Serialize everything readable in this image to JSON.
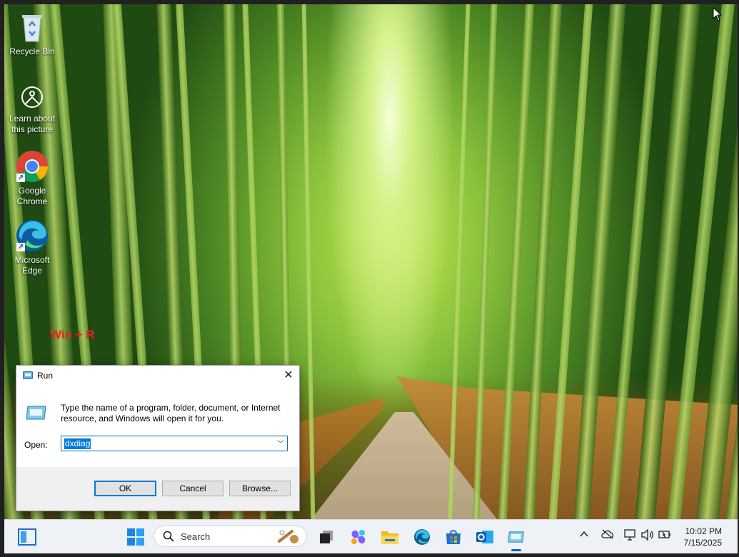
{
  "desktop": {
    "icons": [
      {
        "label": "Recycle Bin",
        "icon": "recycle-bin-icon"
      },
      {
        "label": "Learn about this picture",
        "icon": "learn-about-picture-icon"
      },
      {
        "label": "Google Chrome",
        "icon": "chrome-icon"
      },
      {
        "label": "Microsoft Edge",
        "icon": "edge-icon"
      }
    ],
    "annotation": "Win + R"
  },
  "run_dialog": {
    "title": "Run",
    "description": "Type the name of a program, folder, document, or Internet resource, and Windows will open it for you.",
    "open_label": "Open:",
    "open_value": "dxdiag",
    "ok_label": "OK",
    "cancel_label": "Cancel",
    "browse_label": "Browse..."
  },
  "taskbar": {
    "search_placeholder": "Search",
    "apps": [
      "widgets-icon",
      "start-icon",
      "task-view-icon",
      "copilot-icon",
      "file-explorer-icon",
      "edge-icon",
      "store-icon",
      "outlook-icon",
      "run-icon"
    ],
    "clock": {
      "time": "10:02 PM",
      "date": "7/15/2025"
    }
  },
  "colors": {
    "accent": "#0067c0",
    "annotation": "#e0261c"
  }
}
